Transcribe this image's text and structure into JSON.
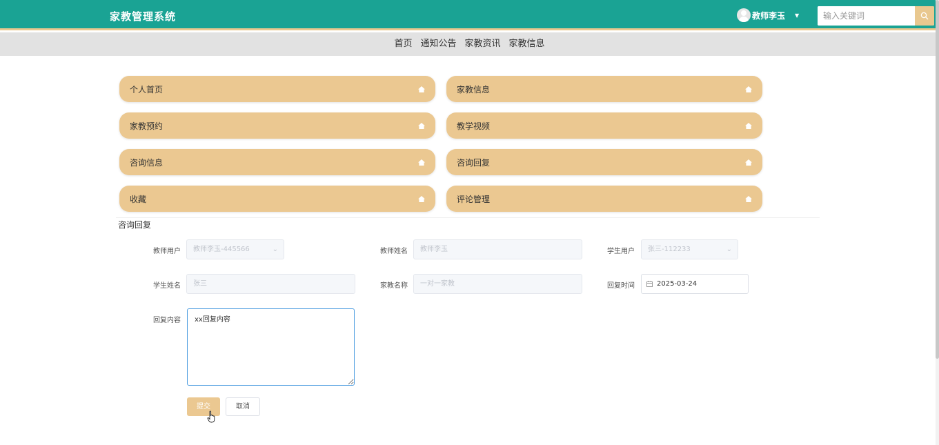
{
  "header": {
    "brand": "家教管理系统",
    "user_name": "教师李玉",
    "search_placeholder": "输入关键词"
  },
  "nav": [
    "首页",
    "通知公告",
    "家教资讯",
    "家教信息"
  ],
  "menu": [
    "个人首页",
    "家教信息",
    "家教预约",
    "教学视频",
    "咨询信息",
    "咨询回复",
    "收藏",
    "评论管理"
  ],
  "section_title": "咨询回复",
  "form": {
    "teacher_user": {
      "label": "教师用户",
      "value": "教师李玉-445566"
    },
    "teacher_name": {
      "label": "教师姓名",
      "value": "教师李玉"
    },
    "student_user": {
      "label": "学生用户",
      "value": "张三-112233"
    },
    "student_name": {
      "label": "学生姓名",
      "value": "张三"
    },
    "tutor_name": {
      "label": "家教名称",
      "value": "一对一家教"
    },
    "reply_time": {
      "label": "回复时间",
      "value": "2025-03-24"
    },
    "reply_content": {
      "label": "回复内容",
      "value": "xx回复内容"
    }
  },
  "buttons": {
    "submit": "提交",
    "cancel": "取消"
  },
  "colors": {
    "topbar": "#1aa394",
    "accent": "#ebc891",
    "nav_bg": "#e2e2e2"
  }
}
